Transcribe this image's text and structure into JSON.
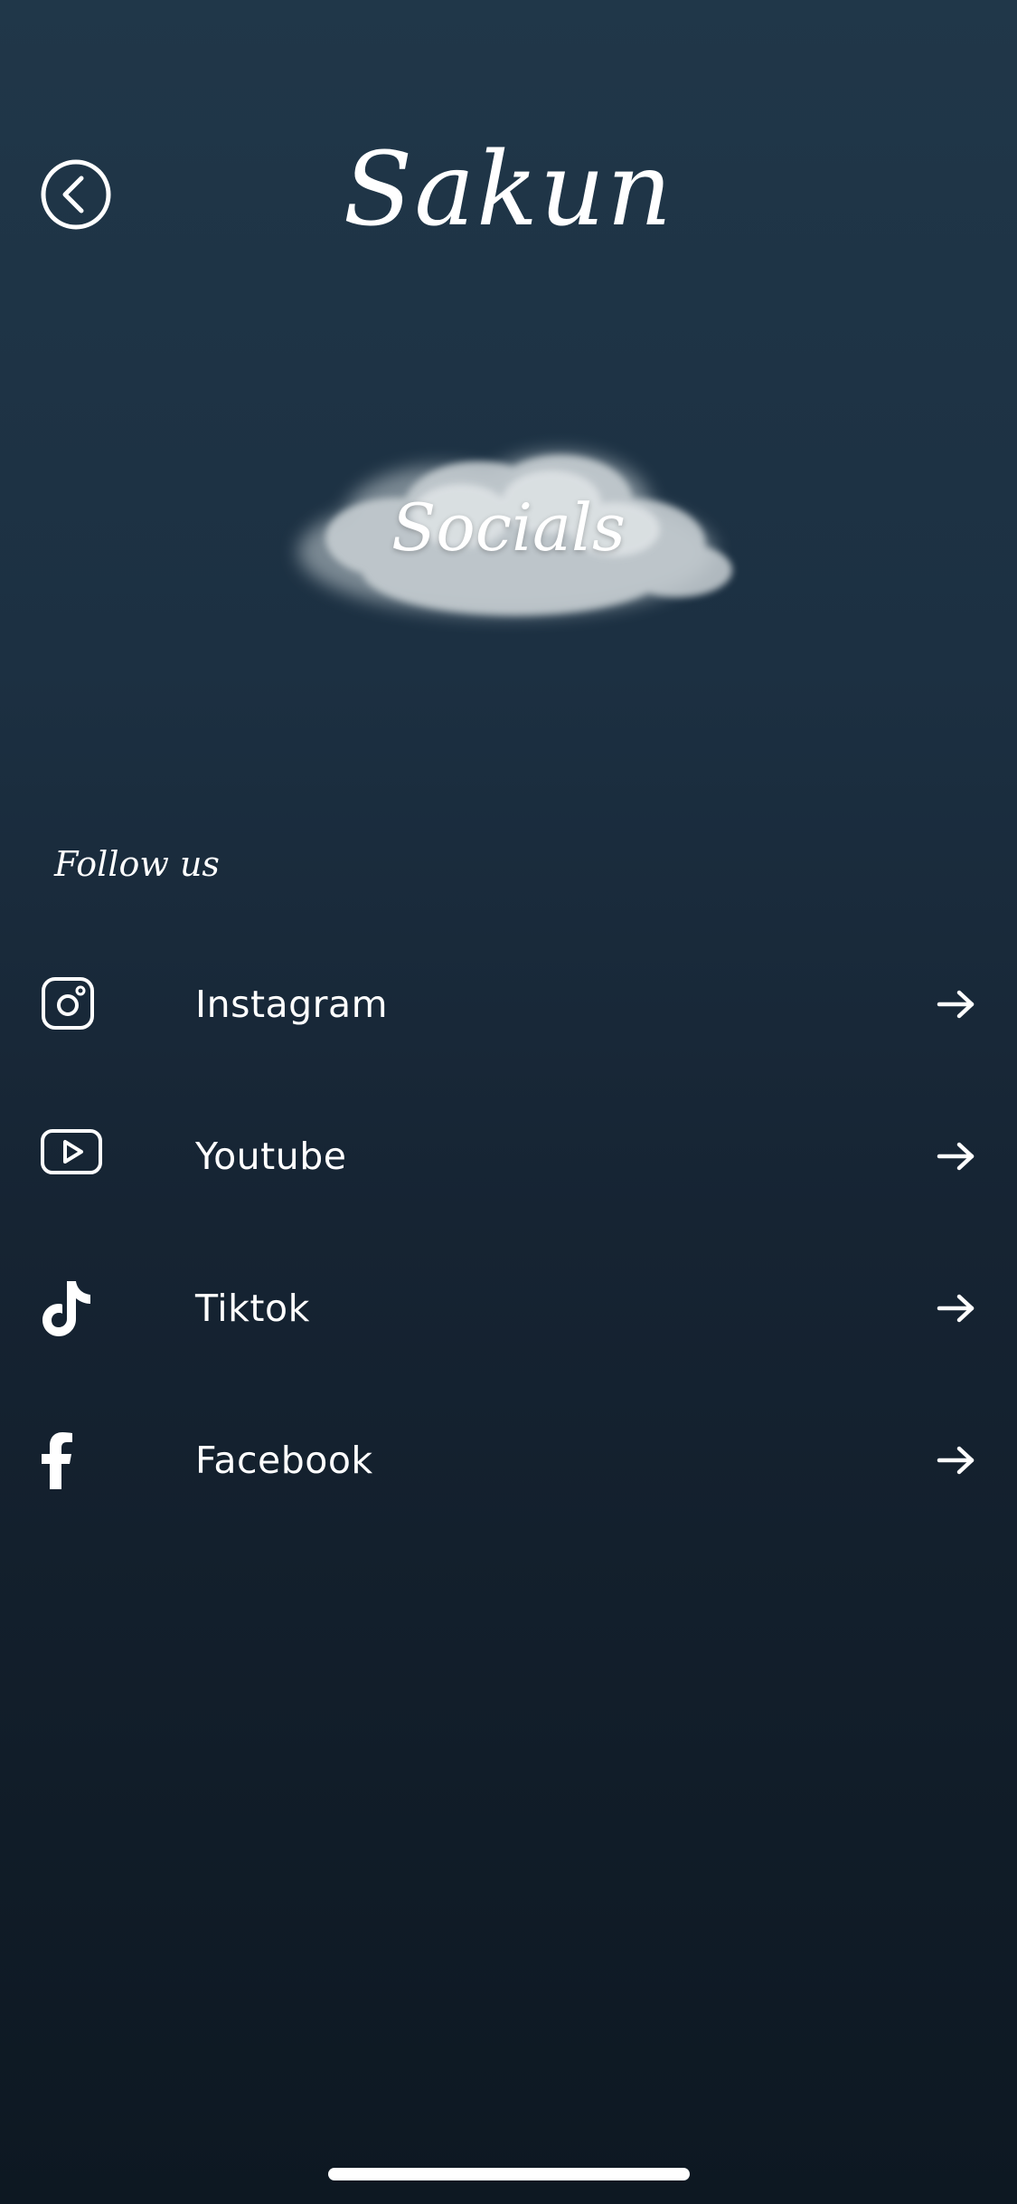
{
  "header": {
    "app_title": "Sakun"
  },
  "hero": {
    "section_title": "Socials"
  },
  "follow": {
    "label": "Follow us"
  },
  "socials": [
    {
      "label": "Instagram",
      "icon": "instagram-icon"
    },
    {
      "label": "Youtube",
      "icon": "youtube-icon"
    },
    {
      "label": "Tiktok",
      "icon": "tiktok-icon"
    },
    {
      "label": "Facebook",
      "icon": "facebook-icon"
    }
  ],
  "colors": {
    "background_top": "#203749",
    "background_bottom": "#0d1822",
    "foreground": "#ffffff"
  }
}
